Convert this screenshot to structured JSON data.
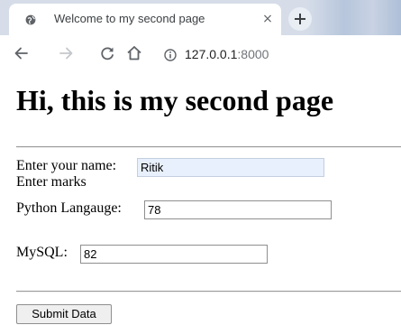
{
  "browser": {
    "tab": {
      "title": "Welcome to my second page",
      "close_glyph": "×",
      "favicon": "globe-icon"
    },
    "new_tab_icon": "plus-icon",
    "nav": {
      "back_icon": "back-arrow-icon",
      "forward_icon": "forward-arrow-icon",
      "reload_icon": "reload-icon",
      "home_icon": "home-icon"
    },
    "address": {
      "security_icon": "info-icon",
      "host": "127.0.0.1",
      "port": ":8000"
    }
  },
  "page": {
    "heading": "Hi, this is my second page",
    "form": {
      "name_label": "Enter your name:",
      "name_value": "Ritik",
      "marks_label": "Enter marks",
      "python_label": "Python Langauge:",
      "python_value": "78",
      "mysql_label": "MySQL:",
      "mysql_value": "82",
      "submit_label": "Submit Data"
    }
  },
  "colors": {
    "tabstrip": "#d6dde9",
    "autofill": "#e8f0fe",
    "icon": "#5f6368"
  }
}
